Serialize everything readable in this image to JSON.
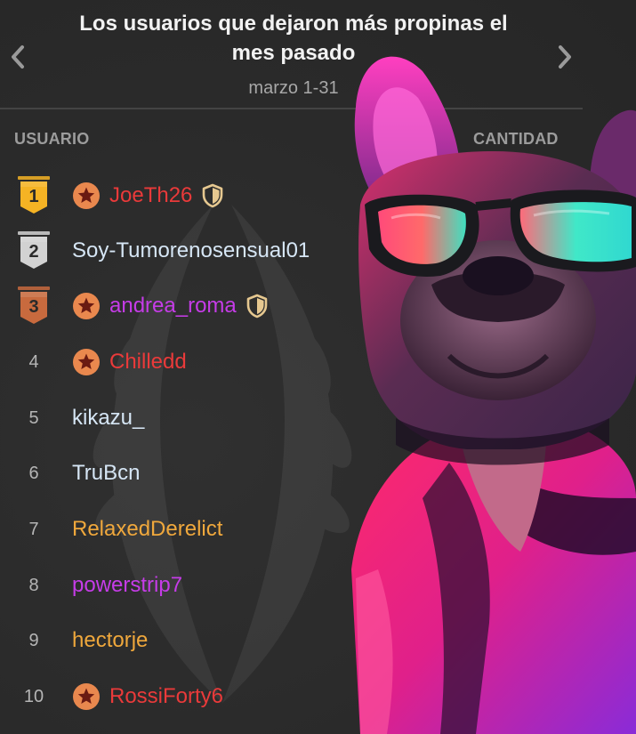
{
  "header": {
    "title_line1": "Los usuarios que dejaron más propinas el",
    "title_line2": "mes pasado",
    "date_range": "marzo 1-31",
    "prev_icon": "chevron-left-icon",
    "next_icon": "chevron-right-icon"
  },
  "columns": {
    "user": "USUARIO",
    "amount": "CANTIDAD"
  },
  "colors": {
    "red": "#ea3a3a",
    "purple": "#c63ce8",
    "orange": "#f0a83c",
    "light": "#d6e6f5",
    "gold": "#f5b324",
    "silver": "#d2d2d2",
    "bronze": "#c86a3e",
    "star_bg": "#e9884e"
  },
  "leaderboard": [
    {
      "rank": "1",
      "name": "JoeTh26",
      "medal": "gold",
      "star": true,
      "shield": true,
      "color": "#ea3a3a"
    },
    {
      "rank": "2",
      "name": "Soy-Tumorenosensual01",
      "medal": "silver",
      "star": false,
      "shield": false,
      "color": "#d6e6f5"
    },
    {
      "rank": "3",
      "name": "andrea_roma",
      "medal": "bronze",
      "star": true,
      "shield": true,
      "color": "#c63ce8"
    },
    {
      "rank": "4",
      "name": "Chilledd",
      "medal": null,
      "star": true,
      "shield": false,
      "color": "#ea3a3a"
    },
    {
      "rank": "5",
      "name": "kikazu_",
      "medal": null,
      "star": false,
      "shield": false,
      "color": "#d6e6f5"
    },
    {
      "rank": "6",
      "name": "TruBcn",
      "medal": null,
      "star": false,
      "shield": false,
      "color": "#d6e6f5"
    },
    {
      "rank": "7",
      "name": "RelaxedDerelict",
      "medal": null,
      "star": false,
      "shield": false,
      "color": "#f0a83c"
    },
    {
      "rank": "8",
      "name": "powerstrip7",
      "medal": null,
      "star": false,
      "shield": false,
      "color": "#c63ce8"
    },
    {
      "rank": "9",
      "name": "hectorje",
      "medal": null,
      "star": false,
      "shield": false,
      "color": "#f0a83c"
    },
    {
      "rank": "10",
      "name": "RossiForty6",
      "medal": null,
      "star": true,
      "shield": false,
      "color": "#ea3a3a"
    }
  ]
}
